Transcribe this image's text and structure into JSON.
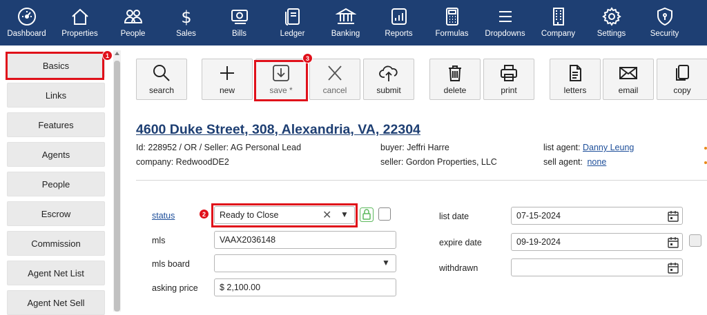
{
  "nav": {
    "items": [
      {
        "label": "Dashboard",
        "icon": "dashboard-gauge-icon"
      },
      {
        "label": "Properties",
        "icon": "house-icon"
      },
      {
        "label": "People",
        "icon": "people-icon"
      },
      {
        "label": "Sales",
        "icon": "dollar-icon"
      },
      {
        "label": "Bills",
        "icon": "bills-money-icon"
      },
      {
        "label": "Ledger",
        "icon": "ledger-book-icon"
      },
      {
        "label": "Banking",
        "icon": "bank-icon"
      },
      {
        "label": "Reports",
        "icon": "bar-chart-icon"
      },
      {
        "label": "Formulas",
        "icon": "calculator-icon"
      },
      {
        "label": "Dropdowns",
        "icon": "list-menu-icon"
      },
      {
        "label": "Company",
        "icon": "building-icon"
      },
      {
        "label": "Settings",
        "icon": "gear-icon"
      },
      {
        "label": "Security",
        "icon": "shield-lock-icon"
      }
    ]
  },
  "sidebar": {
    "items": [
      {
        "label": "Basics"
      },
      {
        "label": "Links"
      },
      {
        "label": "Features"
      },
      {
        "label": "Agents"
      },
      {
        "label": "People"
      },
      {
        "label": "Escrow"
      },
      {
        "label": "Commission"
      },
      {
        "label": "Agent Net List"
      },
      {
        "label": "Agent Net Sell"
      }
    ]
  },
  "toolbar": {
    "search": "search",
    "new": "new",
    "save": "save *",
    "cancel": "cancel",
    "submit": "submit",
    "delete": "delete",
    "print": "print",
    "letters": "letters",
    "email": "email",
    "copy": "copy"
  },
  "callouts": [
    "1",
    "2",
    "3"
  ],
  "property": {
    "address": "4600 Duke Street, 308, Alexandria, VA, 22304",
    "id_line": "Id: 228952 / OR / Seller: AG Personal Lead",
    "company_line": "company: RedwoodDE2",
    "buyer_line": "buyer: Jeffri Harre",
    "seller_line": "seller: Gordon Properties, LLC",
    "list_agent_label": "list agent:",
    "list_agent": "Danny Leung",
    "sell_agent_label": "sell agent:",
    "sell_agent": "none"
  },
  "form": {
    "status_label": "status",
    "status_value": "Ready to Close",
    "mls_label": "mls",
    "mls_value": "VAAX2036148",
    "mls_board_label": "mls board",
    "mls_board_value": "",
    "asking_price_label": "asking price",
    "asking_price_value": "$ 2,100.00",
    "list_date_label": "list date",
    "list_date_value": "07-15-2024",
    "expire_date_label": "expire date",
    "expire_date_value": "09-19-2024",
    "withdrawn_label": "withdrawn",
    "withdrawn_value": ""
  },
  "colors": {
    "nav_bg": "#1e3f73",
    "highlight": "#e0101a",
    "link": "#1e4f9a",
    "lock_green": "#5cb85c"
  }
}
